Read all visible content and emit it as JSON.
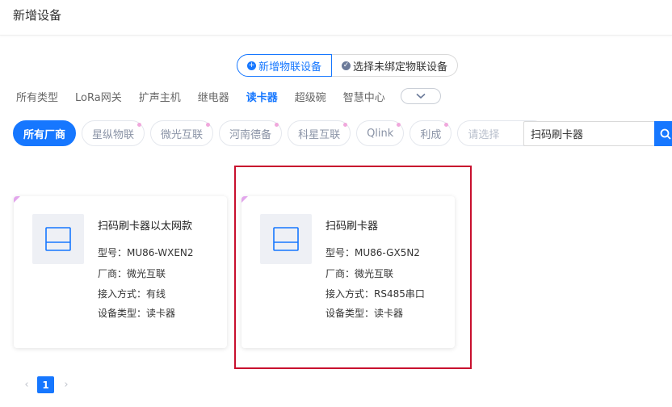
{
  "header": {
    "title": "新增设备"
  },
  "mode_toggle": {
    "add_iot": "新增物联设备",
    "select_unbound": "选择未绑定物联设备"
  },
  "type_tabs": [
    {
      "label": "所有类型",
      "active": false
    },
    {
      "label": "LoRa网关",
      "active": false
    },
    {
      "label": "扩声主机",
      "active": false
    },
    {
      "label": "继电器",
      "active": false
    },
    {
      "label": "读卡器",
      "active": true
    },
    {
      "label": "超级碗",
      "active": false
    },
    {
      "label": "智慧中心",
      "active": false
    }
  ],
  "vendors": [
    {
      "label": "所有厂商",
      "active": true
    },
    {
      "label": "星纵物联",
      "active": false
    },
    {
      "label": "微光互联",
      "active": false
    },
    {
      "label": "河南德备",
      "active": false
    },
    {
      "label": "科星互联",
      "active": false
    },
    {
      "label": "Qlink",
      "active": false
    },
    {
      "label": "利成",
      "active": false
    }
  ],
  "vendor_select": {
    "placeholder": "请选择"
  },
  "search": {
    "value": "扫码刷卡器"
  },
  "cards": [
    {
      "title": "扫码刷卡器以太网款",
      "model": "型号：MU86-WXEN2",
      "vendor": "厂商：微光互联",
      "access": "接入方式：有线",
      "device_type": "设备类型：读卡器"
    },
    {
      "title": "扫码刷卡器",
      "model": "型号：MU86-GX5N2",
      "vendor": "厂商：微光互联",
      "access": "接入方式：RS485串口",
      "device_type": "设备类型：读卡器"
    }
  ],
  "pagination": {
    "current": "1",
    "prev_icon": "chevron-left-icon",
    "next_icon": "chevron-right-icon"
  },
  "colors": {
    "accent": "#1677ff",
    "highlight": "#c8102e",
    "corner": "#e2a6ec"
  }
}
